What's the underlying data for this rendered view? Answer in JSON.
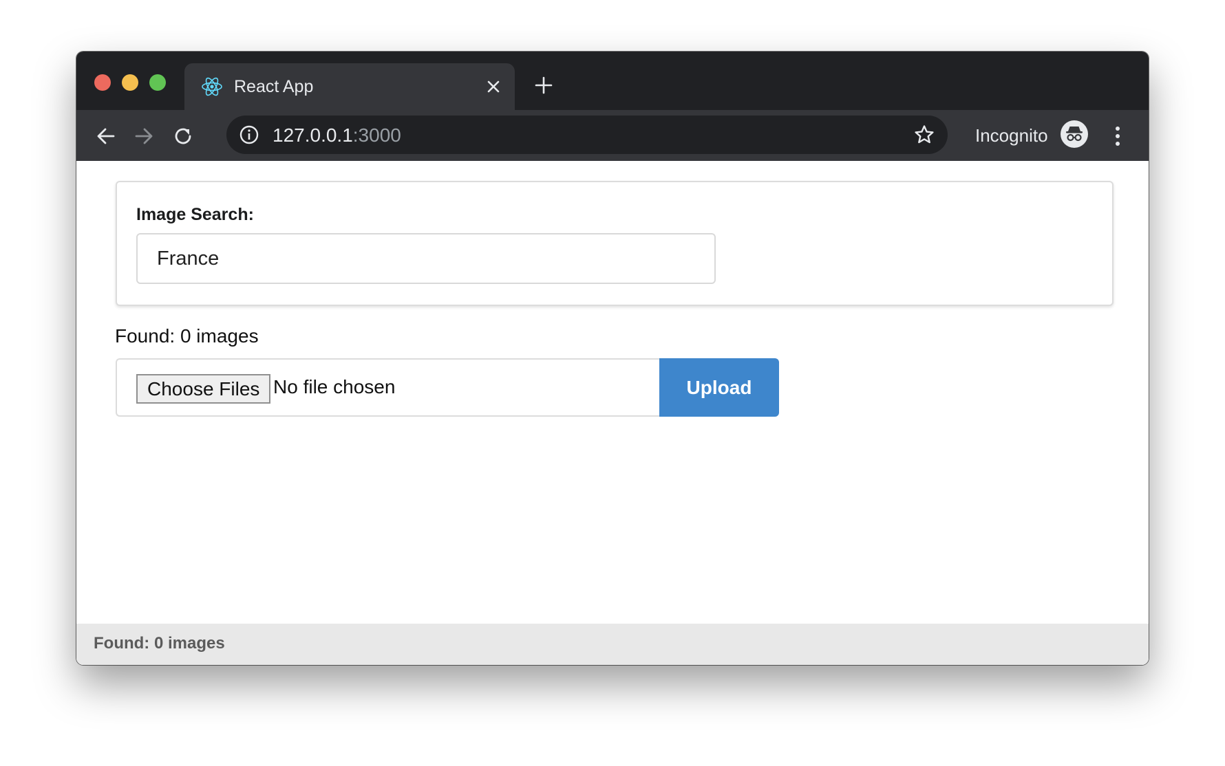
{
  "browser": {
    "tab": {
      "title": "React App",
      "favicon": "react-logo-icon"
    },
    "address": {
      "host": "127.0.0.1",
      "port": ":3000"
    },
    "profile_label": "Incognito",
    "colors": {
      "frame": "#202124",
      "toolbar": "#35363a"
    }
  },
  "search": {
    "label": "Image Search:",
    "value": "France"
  },
  "results": {
    "found_text": "Found: 0 images"
  },
  "uploader": {
    "choose_label": "Choose Files",
    "status_text": "No file chosen",
    "upload_label": "Upload",
    "accent_color": "#3e86cc"
  },
  "footer": {
    "status_text": "Found: 0 images"
  }
}
